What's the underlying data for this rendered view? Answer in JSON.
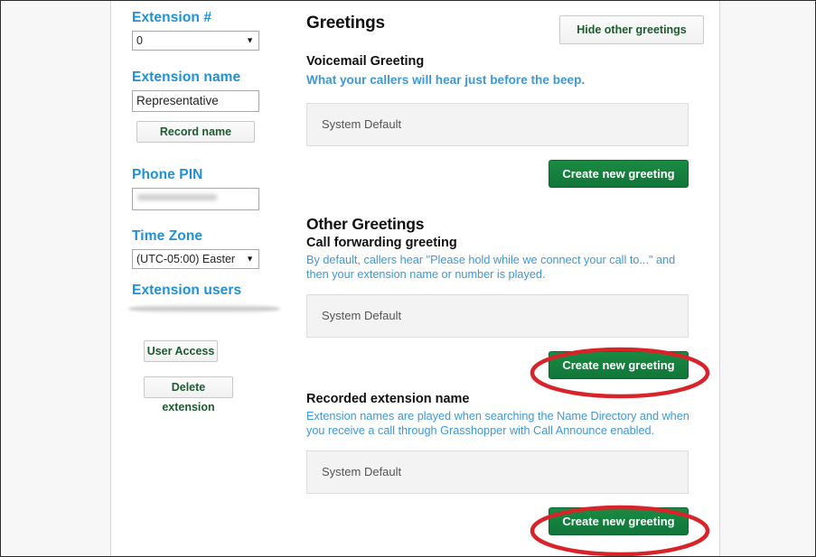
{
  "sidebar": {
    "extension_number": {
      "label": "Extension #",
      "value": "0",
      "caret": "▼"
    },
    "extension_name": {
      "label": "Extension name",
      "value": "Representative"
    },
    "record_name_button": "Record name",
    "phone_pin": {
      "label": "Phone PIN",
      "value": ""
    },
    "time_zone": {
      "label": "Time Zone",
      "value": "(UTC-05:00) Easter",
      "caret": "▼"
    },
    "extension_users": {
      "label": "Extension users"
    },
    "user_access_button": "User Access",
    "delete_extension_button": "Delete extension"
  },
  "main": {
    "page_title": "Greetings",
    "hide_other_button": "Hide other greetings",
    "voicemail": {
      "heading": "Voicemail Greeting",
      "description": "What your callers will hear just before the beep.",
      "current_value": "System Default",
      "create_button": "Create new greeting"
    },
    "other_greetings_heading": "Other Greetings",
    "call_forwarding": {
      "heading": "Call forwarding greeting",
      "description": "By default, callers hear \"Please hold while we connect your call to...\" and then your extension name or number is played.",
      "current_value": "System Default",
      "create_button": "Create new greeting"
    },
    "recorded_extension_name": {
      "heading": "Recorded extension name",
      "description": "Extension names are played when searching the Name Directory and when you receive a call through Grasshopper with Call Announce enabled.",
      "current_value": "System Default",
      "create_button": "Create new greeting"
    }
  },
  "colors": {
    "link_blue": "#3e97d6",
    "label_blue": "#1e91d6",
    "green_button": "#17873a",
    "green_text": "#1d5b2f",
    "annotation_red": "#d9232a"
  },
  "annotations": [
    {
      "name": "highlight-call-forwarding-create",
      "shape": "ellipse",
      "color": "#d9232a"
    },
    {
      "name": "highlight-recorded-name-create",
      "shape": "ellipse",
      "color": "#d9232a"
    }
  ]
}
